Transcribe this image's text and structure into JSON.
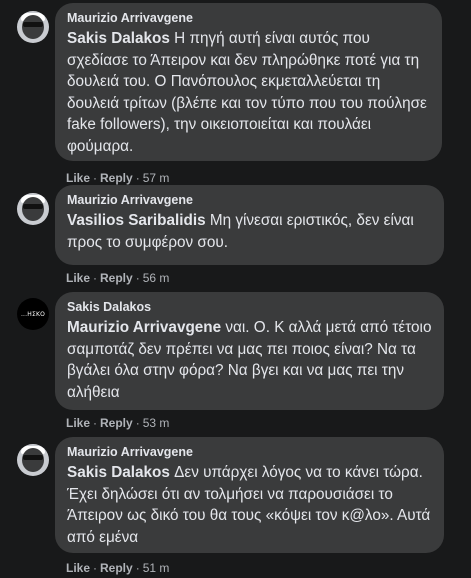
{
  "comments": [
    {
      "author": "Maurizio Arrivavgene",
      "mention": "Sakis Dalakos",
      "text": " Η πηγή αυτή είναι αυτός που σχεδίασε το Άπειρον και δεν πληρώθηκε ποτέ για τη δουλειά του. Ο Πανόπουλος εκμεταλλεύεται τη δουλειά τρίτων (βλέπε και τον τύπο που του πούλησε fake followers), την οικειοποιείται και πουλάει φούμαρα.",
      "like": "Like",
      "reply": "Reply",
      "time": "57 m",
      "avatar": "profile-photo"
    },
    {
      "author": "Maurizio Arrivavgene",
      "mention": "Vasilios Saribalidis",
      "text": " Μη γίνεσαι εριστικός, δεν είναι προς το συμφέρον σου.",
      "like": "Like",
      "reply": "Reply",
      "time": "56 m",
      "avatar": "profile-photo"
    },
    {
      "author": "Sakis Dalakos",
      "mention": "Maurizio Arrivavgene",
      "text": " ναι. Ο. Κ αλλά μετά από τέτοιο σαμποτάζ δεν πρέπει να μας πει ποιος είναι? Να τα βγάλει όλα στην φόρα? Να βγει και να μας πει την αλήθεια",
      "like": "Like",
      "reply": "Reply",
      "time": "53 m",
      "avatar": "logo",
      "avatar_text": "...ΗΣΚΟ"
    },
    {
      "author": "Maurizio Arrivavgene",
      "mention": "Sakis Dalakos",
      "text": " Δεν υπάρχει λόγος να το κάνει τώρα. Έχει δηλώσει ότι αν τολμήσει να παρουσιάσει το Άπειρον ως δικό του θα τους «κόψει τον κ@λο». Αυτά από εμένα",
      "like": "Like",
      "reply": "Reply",
      "time": "51 m",
      "avatar": "profile-photo"
    }
  ],
  "colors": {
    "background": "#18191a",
    "bubble": "#3a3b3c",
    "text": "#e4e6eb",
    "secondary": "#b0b3b8"
  }
}
